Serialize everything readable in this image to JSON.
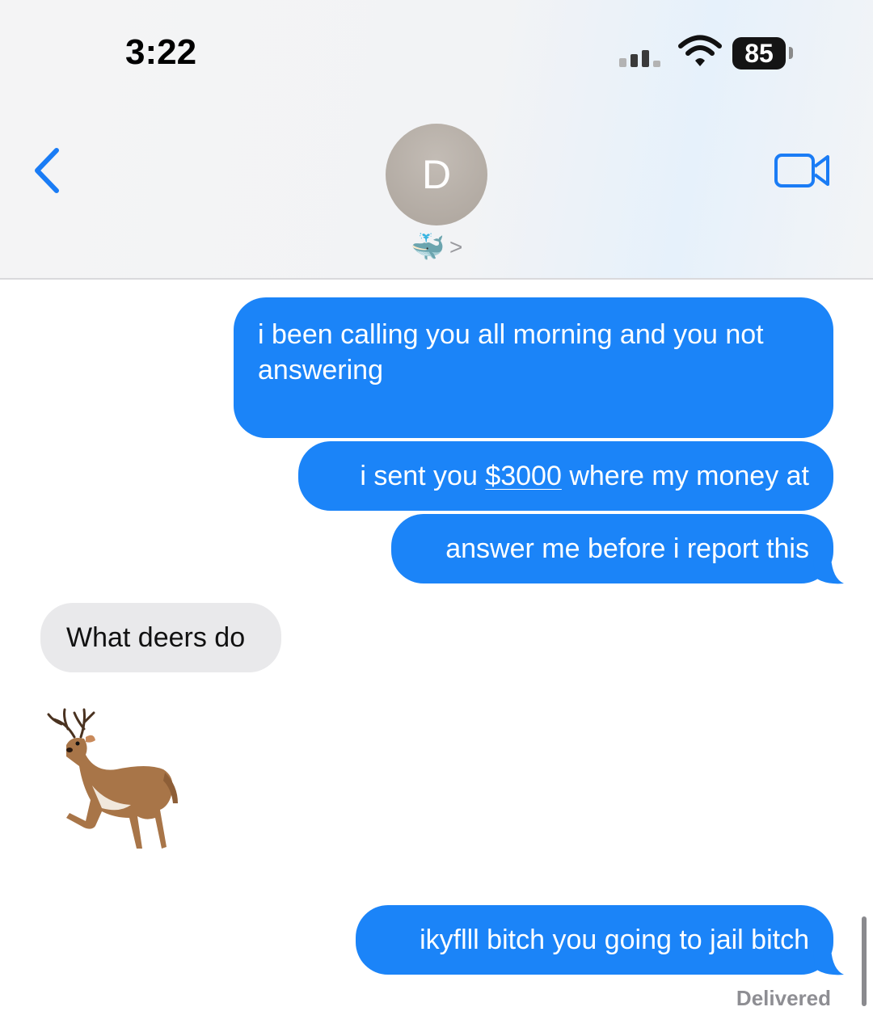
{
  "status_bar": {
    "time": "3:22",
    "battery": "85"
  },
  "nav": {
    "contact_initial": "D",
    "contact_name_emoji": "🐳",
    "chevron": ">",
    "back_icon": "chevron-left-icon",
    "video_icon": "video-camera-icon"
  },
  "messages": [
    {
      "direction": "sent",
      "text": "i been calling you all morning and you not answering"
    },
    {
      "direction": "sent",
      "prefix": "i sent you ",
      "link": "$3000",
      "suffix": " where my money at"
    },
    {
      "direction": "sent",
      "text": "answer me before i report this"
    },
    {
      "direction": "received",
      "text": "What deers do"
    },
    {
      "direction": "received",
      "emoji": "deer"
    },
    {
      "direction": "sent",
      "text": "ikyflll bitch you going to jail bitch"
    }
  ],
  "delivery_status": "Delivered",
  "colors": {
    "sent_bubble": "#1b84f8",
    "received_bubble": "#e9e9eb",
    "accent": "#1a7cf5"
  }
}
